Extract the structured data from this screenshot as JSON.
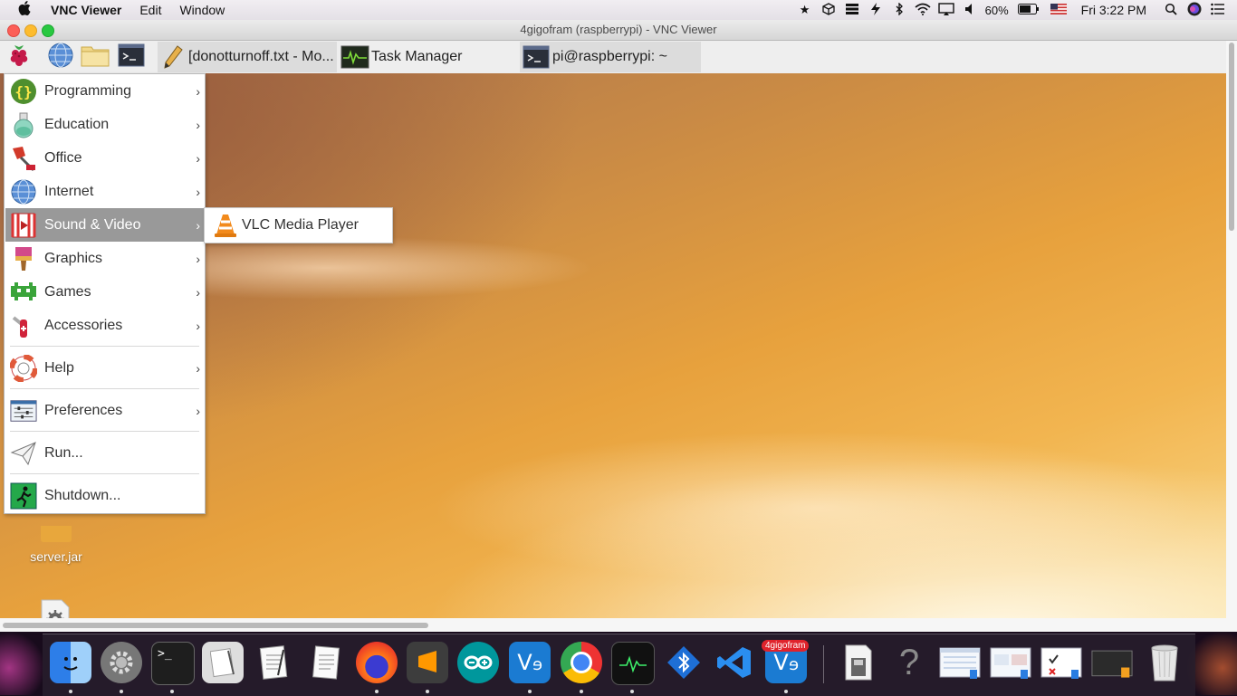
{
  "mac_menubar": {
    "app_name": "VNC Viewer",
    "menus": [
      "Edit",
      "Window"
    ],
    "battery": "60%",
    "clock": "Fri 3:22 PM"
  },
  "window": {
    "title": "4gigofram (raspberrypi) - VNC Viewer"
  },
  "pi_panel": {
    "tasks": [
      {
        "label": "[donotturnoff.txt - Mo...",
        "icon": "pencil-icon"
      },
      {
        "label": "Task Manager",
        "icon": "monitor-icon"
      },
      {
        "label": "pi@raspberrypi: ~",
        "icon": "terminal-icon"
      }
    ]
  },
  "menu": {
    "items": [
      {
        "label": "Programming",
        "icon": "programming-icon"
      },
      {
        "label": "Education",
        "icon": "flask-icon"
      },
      {
        "label": "Office",
        "icon": "office-icon"
      },
      {
        "label": "Internet",
        "icon": "globe-icon"
      },
      {
        "label": "Sound & Video",
        "icon": "video-icon"
      },
      {
        "label": "Graphics",
        "icon": "brush-icon"
      },
      {
        "label": "Games",
        "icon": "games-icon"
      },
      {
        "label": "Accessories",
        "icon": "knife-icon"
      },
      {
        "label": "Help",
        "icon": "lifebuoy-icon"
      },
      {
        "label": "Preferences",
        "icon": "preferences-icon"
      },
      {
        "label": "Run...",
        "icon": "paper-plane-icon"
      },
      {
        "label": "Shutdown...",
        "icon": "exit-icon"
      }
    ],
    "submenu": {
      "label": "VLC Media Player",
      "icon": "vlc-icon"
    }
  },
  "desktop": {
    "icons": [
      {
        "label": "server.jar"
      }
    ]
  },
  "dock": {
    "badge": "4gigofram"
  },
  "colors": {
    "menu_highlight": "#999999",
    "panel_bg": "#eeeeee"
  }
}
